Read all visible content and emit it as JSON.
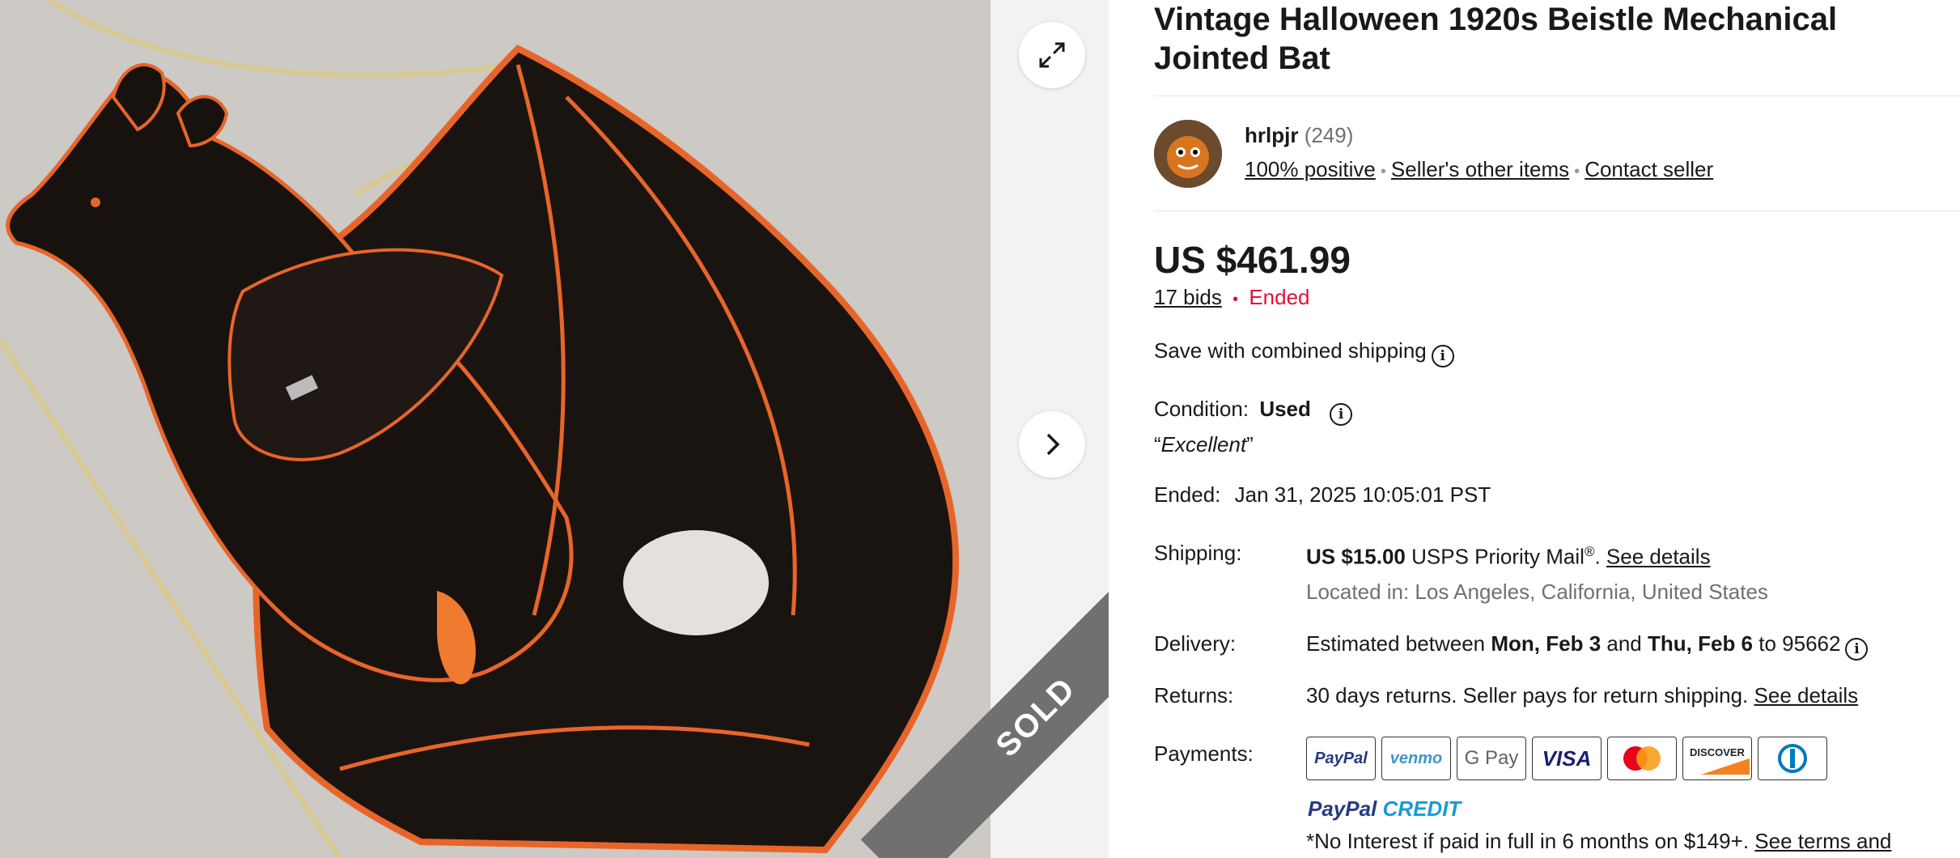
{
  "listing": {
    "title": "Vintage Halloween 1920s Beistle Mechanical Jointed Bat"
  },
  "image": {
    "sold_badge": "SOLD"
  },
  "seller": {
    "name": "hrlpjr",
    "feedback_count": "(249)",
    "positive": "100% positive",
    "other_items": "Seller's other items",
    "contact": "Contact seller"
  },
  "pricing": {
    "price": "US $461.99",
    "bids": "17 bids",
    "status": "Ended",
    "combined_shipping": "Save with combined shipping"
  },
  "details": {
    "condition_label": "Condition:",
    "condition_value": "Used",
    "condition_quote": "Excellent",
    "ended_label": "Ended:",
    "ended_value": "Jan 31, 2025 10:05:01 PST",
    "shipping_label": "Shipping:",
    "shipping_price": "US $15.00",
    "shipping_service": "USPS Priority Mail",
    "shipping_details_link": "See details",
    "shipping_location": "Located in: Los Angeles, California, United States",
    "delivery_label": "Delivery:",
    "delivery_prefix": "Estimated between",
    "delivery_start": "Mon, Feb 3",
    "delivery_and": "and",
    "delivery_end": "Thu, Feb 6",
    "delivery_to": "to 95662",
    "returns_label": "Returns:",
    "returns_text": "30 days returns. Seller pays for return shipping.",
    "returns_link": "See details",
    "payments_label": "Payments:"
  },
  "payments": {
    "methods": [
      "PayPal",
      "venmo",
      "G Pay",
      "VISA",
      "Mastercard",
      "DISCOVER",
      "Diners Club"
    ],
    "paypal_credit_a": "PayPal",
    "paypal_credit_b": "CREDIT",
    "promo_text": "*No Interest if paid in full in 6 months on $149+.",
    "promo_link": "See terms and"
  },
  "colors": {
    "ended": "#e0103a",
    "muted": "#707070",
    "sold_ribbon": "#707070"
  }
}
